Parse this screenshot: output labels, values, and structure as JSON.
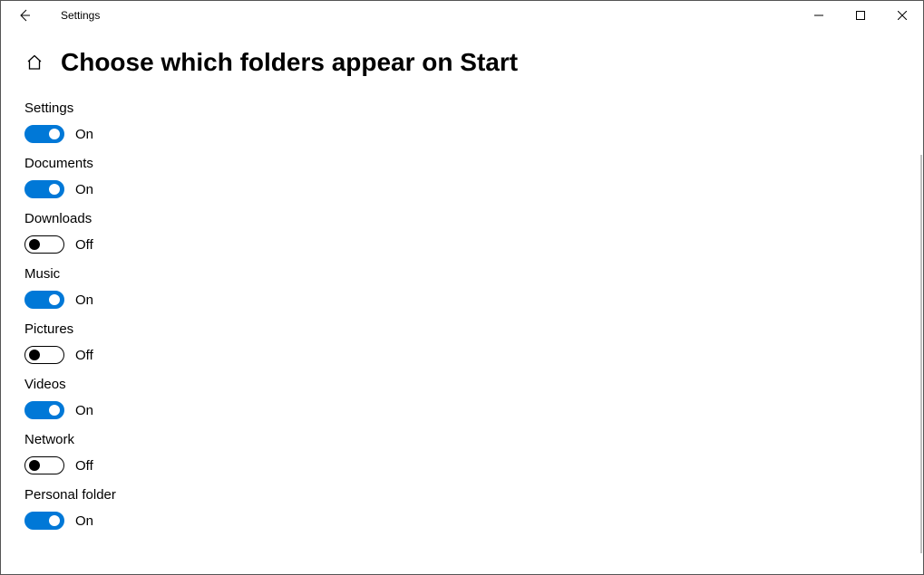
{
  "titlebar": {
    "app_name": "Settings"
  },
  "page": {
    "title": "Choose which folders appear on Start"
  },
  "labels": {
    "on": "On",
    "off": "Off"
  },
  "settings": [
    {
      "key": "settings",
      "label": "Settings",
      "value": true
    },
    {
      "key": "documents",
      "label": "Documents",
      "value": true
    },
    {
      "key": "downloads",
      "label": "Downloads",
      "value": false
    },
    {
      "key": "music",
      "label": "Music",
      "value": true
    },
    {
      "key": "pictures",
      "label": "Pictures",
      "value": false
    },
    {
      "key": "videos",
      "label": "Videos",
      "value": true
    },
    {
      "key": "network",
      "label": "Network",
      "value": false
    },
    {
      "key": "personal",
      "label": "Personal folder",
      "value": true
    }
  ]
}
